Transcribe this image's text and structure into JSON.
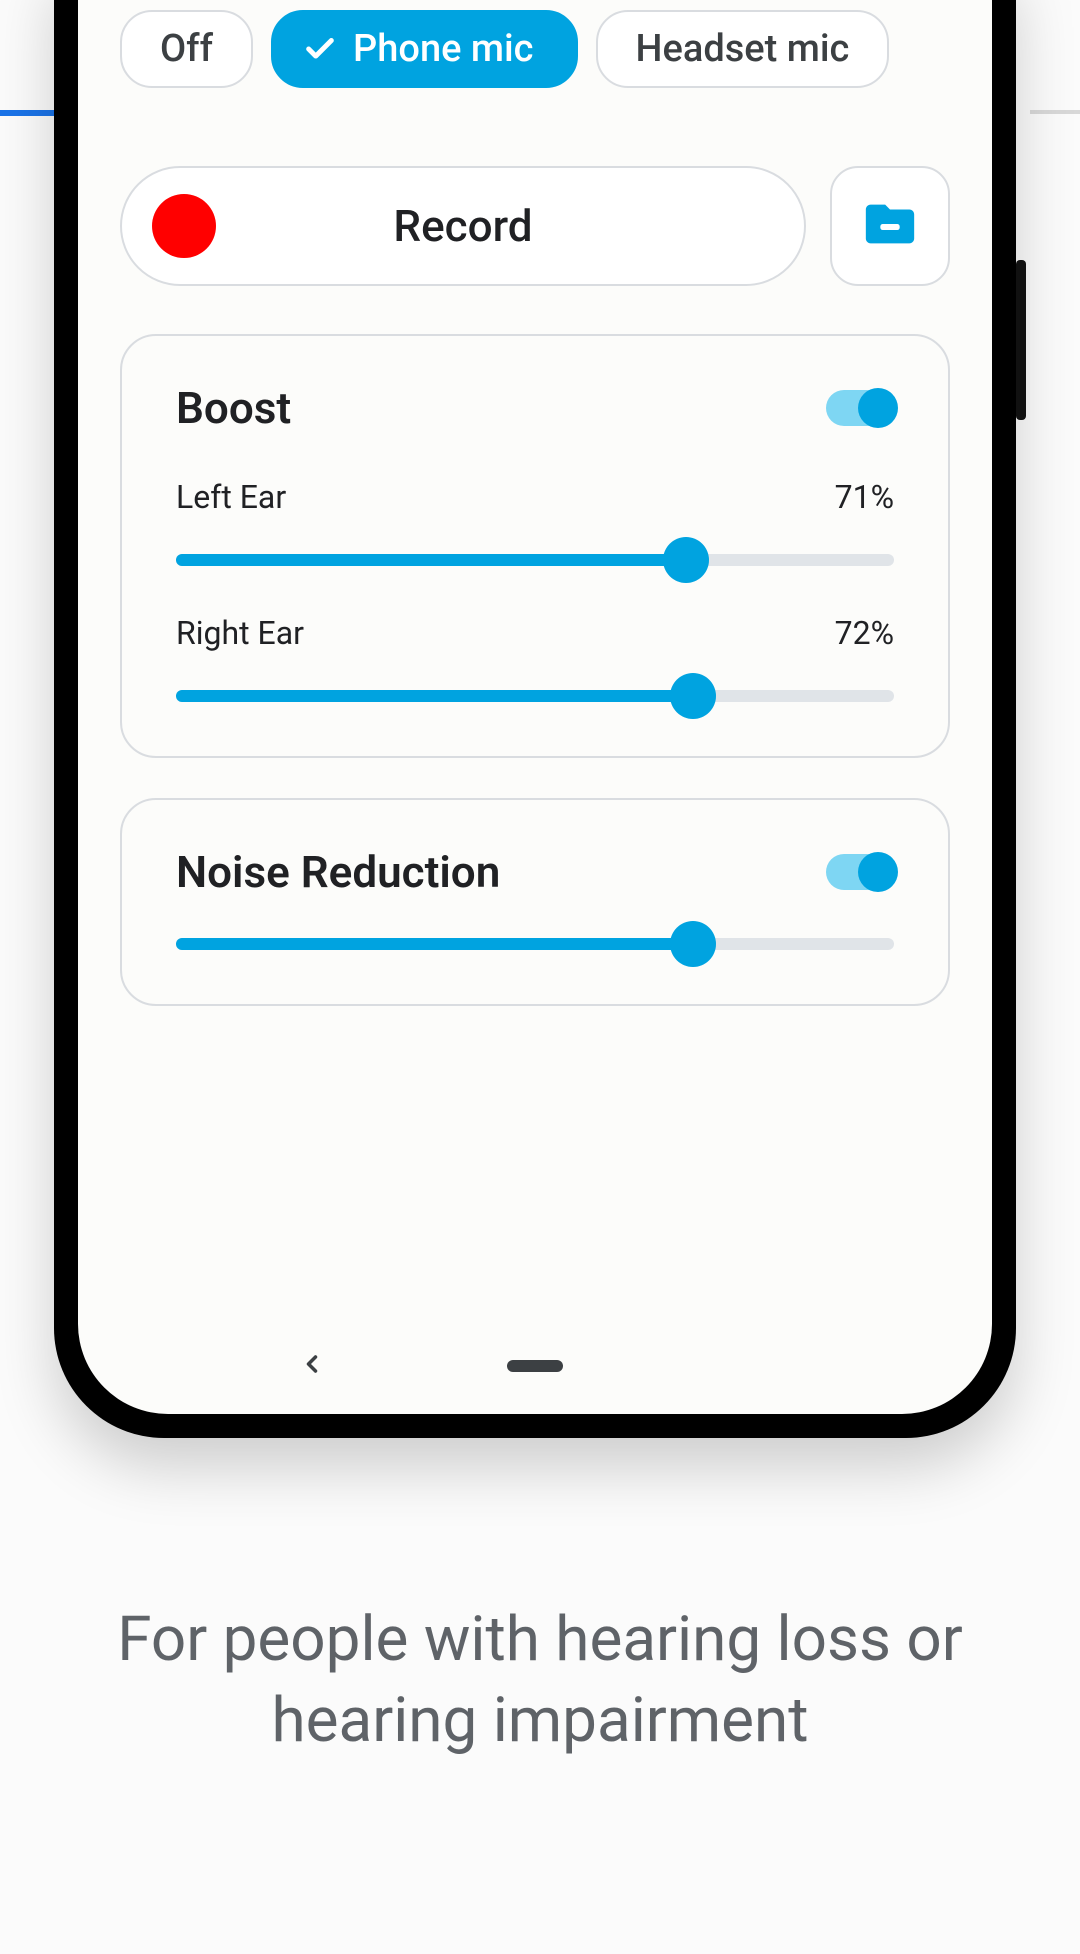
{
  "micSource": {
    "off": "Off",
    "phone": "Phone mic",
    "headset": "Headset mic"
  },
  "record": {
    "label": "Record"
  },
  "boost": {
    "title": "Boost",
    "left": {
      "label": "Left Ear",
      "valueText": "71%",
      "value": 71
    },
    "right": {
      "label": "Right Ear",
      "valueText": "72%",
      "value": 72
    }
  },
  "noise": {
    "title": "Noise Reduction",
    "value": 72
  },
  "caption": "For people with hearing loss or hearing impairment"
}
